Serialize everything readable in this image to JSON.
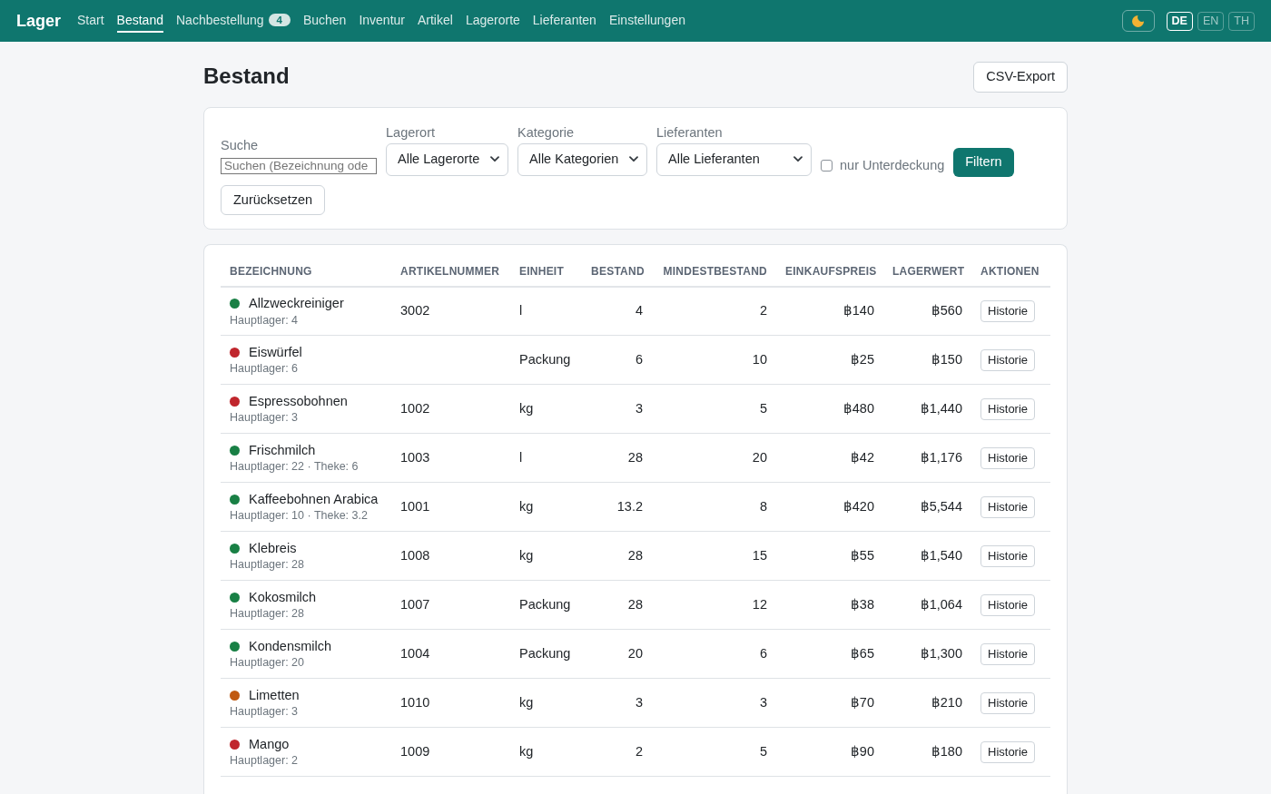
{
  "navbar": {
    "brand": "Lager",
    "items": [
      {
        "label": "Start",
        "selected": false
      },
      {
        "label": "Bestand",
        "selected": true
      },
      {
        "label": "Nachbestellung",
        "selected": false,
        "badge": "4"
      },
      {
        "label": "Buchen",
        "selected": false
      },
      {
        "label": "Inventur",
        "selected": false
      },
      {
        "label": "Artikel",
        "selected": false
      },
      {
        "label": "Lagerorte",
        "selected": false
      },
      {
        "label": "Lieferanten",
        "selected": false
      },
      {
        "label": "Einstellungen",
        "selected": false
      }
    ],
    "languages": [
      {
        "label": "DE",
        "selected": true
      },
      {
        "label": "EN",
        "selected": false
      },
      {
        "label": "TH",
        "selected": false
      }
    ]
  },
  "page": {
    "title": "Bestand",
    "export_button": "CSV-Export"
  },
  "filters": {
    "search": {
      "label": "Suche",
      "placeholder": "Suchen (Bezeichnung ode"
    },
    "selects": [
      {
        "label": "Lagerort",
        "value": "Alle Lagerorte"
      },
      {
        "label": "Kategorie",
        "value": "Alle Kategorien"
      },
      {
        "label": "Lieferanten",
        "value": "Alle Lieferanten"
      }
    ],
    "shortage_only": {
      "label": "nur Unterdeckung",
      "checked": false
    },
    "filter_button": "Filtern",
    "reset_button": "Zurücksetzen"
  },
  "table": {
    "columns": [
      "BEZEICHNUNG",
      "ARTIKELNUMMER",
      "EINHEIT",
      "BESTAND",
      "MINDESTBESTAND",
      "EINKAUFSPREIS",
      "LAGERWERT",
      "AKTIONEN"
    ],
    "rows": [
      {
        "name": "Allzweckreiniger",
        "color": "#198045",
        "locations": "Hauptlager: 4",
        "article_number": "3002",
        "unit": "l",
        "stock": "4",
        "min_stock": "2",
        "purchase_price": "฿140",
        "stock_value": "฿560",
        "action": "Historie"
      },
      {
        "name": "Eiswürfel",
        "color": "#c0262d",
        "locations": "Hauptlager: 6",
        "unit": "Packung",
        "stock": "6",
        "min_stock": "10",
        "purchase_price": "฿25",
        "stock_value": "฿150",
        "action": "Historie"
      },
      {
        "name": "Espressobohnen",
        "color": "#c0262d",
        "locations": "Hauptlager: 3",
        "article_number": "1002",
        "unit": "kg",
        "stock": "3",
        "min_stock": "5",
        "purchase_price": "฿480",
        "stock_value": "฿1,440",
        "action": "Historie"
      },
      {
        "name": "Frischmilch",
        "color": "#198045",
        "locations": "Hauptlager: 22 · Theke: 6",
        "article_number": "1003",
        "unit": "l",
        "stock": "28",
        "min_stock": "20",
        "purchase_price": "฿42",
        "stock_value": "฿1,176",
        "action": "Historie"
      },
      {
        "name": "Kaffeebohnen Arabica",
        "color": "#198045",
        "locations": "Hauptlager: 10 · Theke: 3.2",
        "article_number": "1001",
        "unit": "kg",
        "stock": "13.2",
        "min_stock": "8",
        "purchase_price": "฿420",
        "stock_value": "฿5,544",
        "action": "Historie"
      },
      {
        "name": "Klebreis",
        "color": "#198045",
        "locations": "Hauptlager: 28",
        "article_number": "1008",
        "unit": "kg",
        "stock": "28",
        "min_stock": "15",
        "purchase_price": "฿55",
        "stock_value": "฿1,540",
        "action": "Historie"
      },
      {
        "name": "Kokosmilch",
        "color": "#198045",
        "locations": "Hauptlager: 28",
        "article_number": "1007",
        "unit": "Packung",
        "stock": "28",
        "min_stock": "12",
        "purchase_price": "฿38",
        "stock_value": "฿1,064",
        "action": "Historie"
      },
      {
        "name": "Kondensmilch",
        "color": "#198045",
        "locations": "Hauptlager: 20",
        "article_number": "1004",
        "unit": "Packung",
        "stock": "20",
        "min_stock": "6",
        "purchase_price": "฿65",
        "stock_value": "฿1,300",
        "action": "Historie"
      },
      {
        "name": "Limetten",
        "color": "#c05a12",
        "locations": "Hauptlager: 3",
        "article_number": "1010",
        "unit": "kg",
        "stock": "3",
        "min_stock": "3",
        "purchase_price": "฿70",
        "stock_value": "฿210",
        "action": "Historie"
      },
      {
        "name": "Mango",
        "color": "#c0262d",
        "locations": "Hauptlager: 2",
        "article_number": "1009",
        "unit": "kg",
        "stock": "2",
        "min_stock": "5",
        "purchase_price": "฿90",
        "stock_value": "฿180",
        "action": "Historie"
      }
    ]
  }
}
